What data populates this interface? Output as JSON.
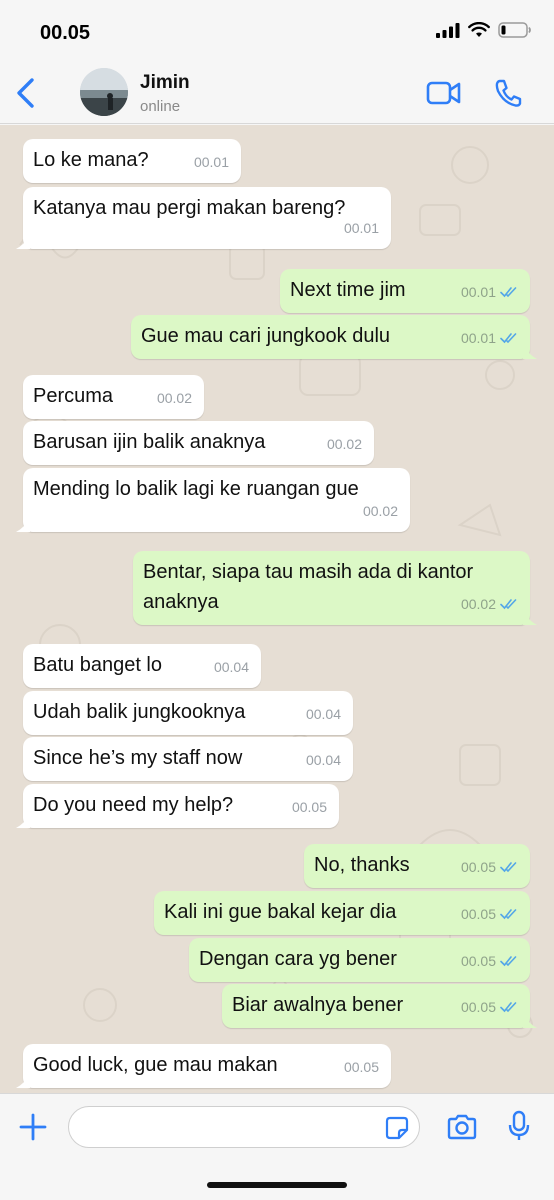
{
  "status_bar": {
    "time": "00.05"
  },
  "header": {
    "contact_name": "Jimin",
    "contact_status": "online"
  },
  "colors": {
    "accent": "#2f7ef7",
    "incoming_bubble": "#ffffff",
    "outgoing_bubble": "#dcf8c6",
    "chat_background": "#e6ded4",
    "read_ticks": "#53a6e8"
  },
  "messages": [
    {
      "direction": "in",
      "text": "Lo ke mana?",
      "time": "00.01"
    },
    {
      "direction": "in",
      "text": "Katanya mau pergi makan bareng?",
      "time": "00.01"
    },
    {
      "direction": "out",
      "text": "Next time jim",
      "time": "00.01",
      "status": "read"
    },
    {
      "direction": "out",
      "text": "Gue mau cari jungkook dulu",
      "time": "00.01",
      "status": "read"
    },
    {
      "direction": "in",
      "text": "Percuma",
      "time": "00.02"
    },
    {
      "direction": "in",
      "text": "Barusan ijin balik anaknya",
      "time": "00.02"
    },
    {
      "direction": "in",
      "text": "Mending lo balik lagi ke ruangan gue",
      "time": "00.02"
    },
    {
      "direction": "out",
      "text": "Bentar, siapa tau masih ada di kantor\nanaknya",
      "time": "00.02",
      "status": "read"
    },
    {
      "direction": "in",
      "text": "Batu banget lo",
      "time": "00.04"
    },
    {
      "direction": "in",
      "text": "Udah balik jungkooknya",
      "time": "00.04"
    },
    {
      "direction": "in",
      "text": "Since he’s my staff now",
      "time": "00.04"
    },
    {
      "direction": "in",
      "text": "Do you need my help?",
      "time": "00.05"
    },
    {
      "direction": "out",
      "text": "No, thanks",
      "time": "00.05",
      "status": "read"
    },
    {
      "direction": "out",
      "text": "Kali ini gue bakal kejar dia",
      "time": "00.05",
      "status": "read"
    },
    {
      "direction": "out",
      "text": "Dengan cara yg bener",
      "time": "00.05",
      "status": "read"
    },
    {
      "direction": "out",
      "text": "Biar awalnya bener",
      "time": "00.05",
      "status": "read"
    },
    {
      "direction": "in",
      "text": "Good luck, gue mau makan",
      "time": "00.05"
    }
  ],
  "input": {
    "value": "",
    "placeholder": ""
  },
  "icons": {
    "back": "chevron-left-icon",
    "video": "video-camera-icon",
    "call": "phone-icon",
    "plus": "plus-icon",
    "sticker": "sticker-icon",
    "camera": "camera-icon",
    "mic": "microphone-icon",
    "signal": "signal-icon",
    "wifi": "wifi-icon",
    "battery": "battery-icon",
    "read": "double-check-icon"
  }
}
